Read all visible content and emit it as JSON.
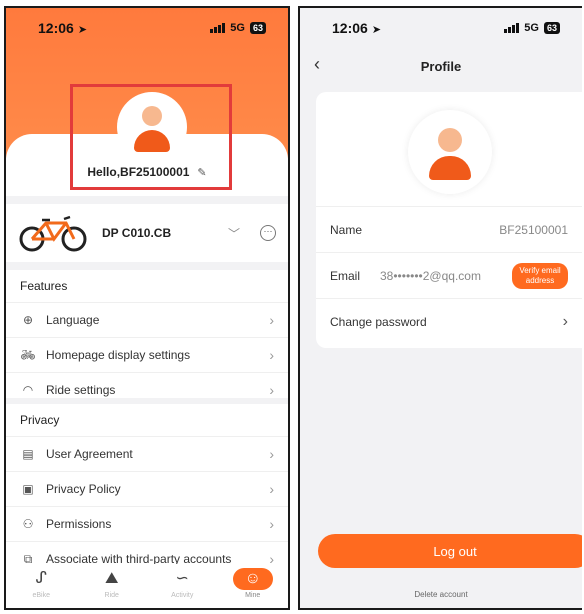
{
  "status": {
    "time": "12:06",
    "network": "5G",
    "battery": "63"
  },
  "left": {
    "greeting": "Hello,BF25100001",
    "bike": {
      "name": "DP C010.CB"
    },
    "features": {
      "title": "Features",
      "items": [
        {
          "label": "Language",
          "icon": "globe-icon"
        },
        {
          "label": "Homepage display settings",
          "icon": "bike-icon"
        },
        {
          "label": "Ride settings",
          "icon": "speedometer-icon"
        }
      ]
    },
    "privacy": {
      "title": "Privacy",
      "items": [
        {
          "label": "User Agreement",
          "icon": "agreement-icon"
        },
        {
          "label": "Privacy Policy",
          "icon": "document-icon"
        },
        {
          "label": "Permissions",
          "icon": "user-icon"
        },
        {
          "label": "Associate with third-party accounts",
          "icon": "link-icon"
        }
      ]
    },
    "tabs": [
      {
        "label": "eBike",
        "active": false
      },
      {
        "label": "Ride",
        "active": false
      },
      {
        "label": "Activity",
        "active": false
      },
      {
        "label": "Mine",
        "active": true
      }
    ]
  },
  "right": {
    "title": "Profile",
    "name_label": "Name",
    "name_value": "BF25100001",
    "email_label": "Email",
    "email_value": "38•••••••2@qq.com",
    "verify_label": "Verify email address",
    "change_password": "Change password",
    "logout": "Log out",
    "delete_account": "Delete account"
  },
  "colors": {
    "accent": "#ff6a1f",
    "highlight_box": "#e23b3b"
  }
}
